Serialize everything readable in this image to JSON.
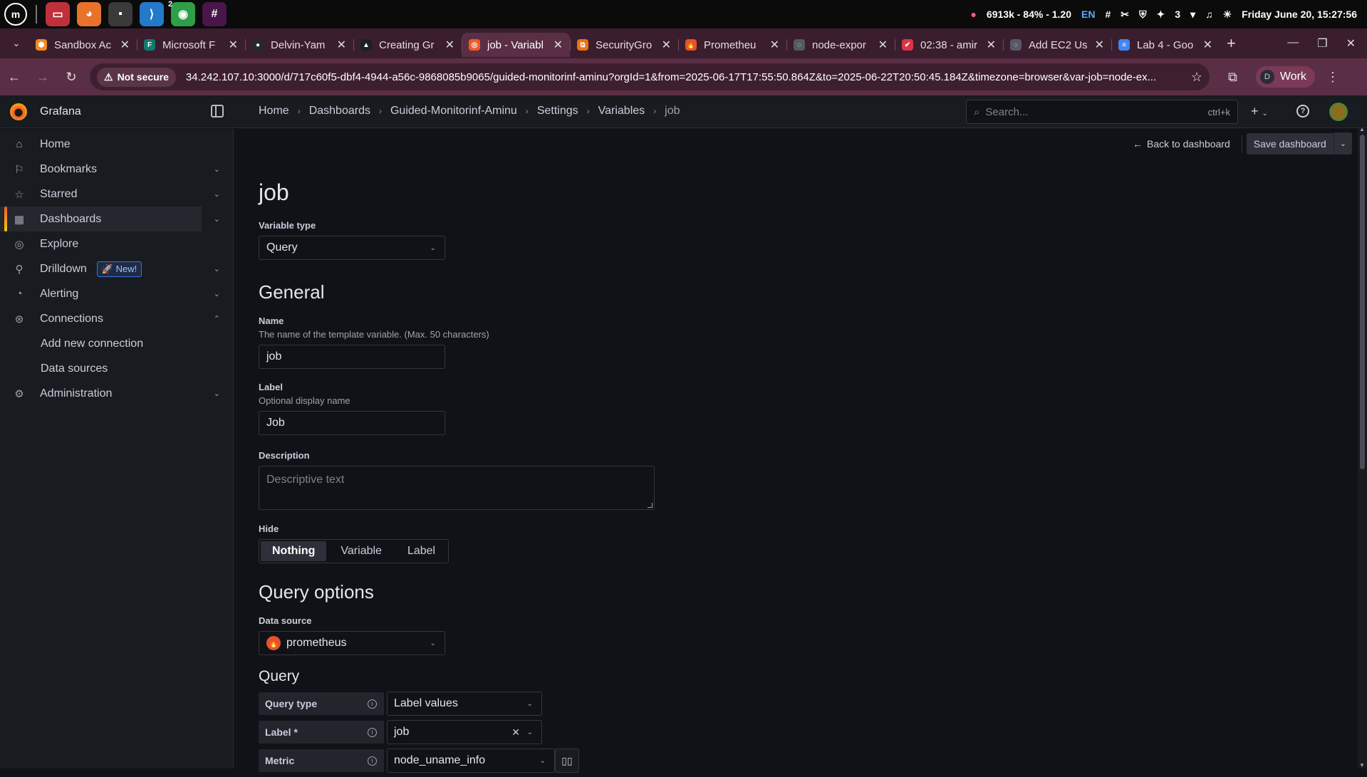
{
  "system": {
    "launcher_icon": "mint-launcher-icon",
    "apps": [
      {
        "name": "files-app-icon",
        "color": "#c0303a",
        "glyph": "▭"
      },
      {
        "name": "firefox-app-icon",
        "color": "#e8722c",
        "glyph": "◕"
      },
      {
        "name": "terminal-app-icon",
        "color": "#3a3a3a",
        "glyph": "▪"
      },
      {
        "name": "vscode-app-icon",
        "color": "#2479c9",
        "glyph": "⟩"
      },
      {
        "name": "chrome-app-icon",
        "color": "#2f9e48",
        "glyph": "◉",
        "badge": "2"
      },
      {
        "name": "slack-app-icon",
        "color": "#4a154b",
        "glyph": "#"
      }
    ],
    "net_status": "6913k - 84% - 1.20",
    "lang": "EN",
    "count": "3",
    "datetime": "Friday June 20, 15:27:56"
  },
  "browser": {
    "tabs": [
      {
        "title": "Sandbox Ac",
        "color": "#f28a26",
        "glyph": "⬢"
      },
      {
        "title": "Microsoft F",
        "color": "#0f7b6c",
        "glyph": "F"
      },
      {
        "title": "Delvin-Yam",
        "color": "#24292e",
        "glyph": "●"
      },
      {
        "title": "Creating Gr",
        "color": "#1b1f2a",
        "glyph": "▲"
      },
      {
        "title": "job - Variabl",
        "color": "#f05a28",
        "glyph": "◎",
        "active": true
      },
      {
        "title": "SecurityGro",
        "color": "#ec7211",
        "glyph": "⧉"
      },
      {
        "title": "Prometheu",
        "color": "#e6522c",
        "glyph": "🔥"
      },
      {
        "title": "node-expor",
        "color": "#555a66",
        "glyph": "◌"
      },
      {
        "title": "02:38 - amir",
        "color": "#db3545",
        "glyph": "✔"
      },
      {
        "title": "Add EC2 Us",
        "color": "#555a66",
        "glyph": "◌"
      },
      {
        "title": "Lab 4 - Goo",
        "color": "#4285f4",
        "glyph": "≡"
      }
    ],
    "not_secure": "Not secure",
    "url": "34.242.107.10:3000/d/717c60f5-dbf4-4944-a56c-9868085b9065/guided-monitorinf-aminu?orgId=1&from=2025-06-17T17:55:50.864Z&to=2025-06-22T20:50:45.184Z&timezone=browser&var-job=node-ex...",
    "profile_initial": "D",
    "profile_name": "Work"
  },
  "grafana": {
    "brand": "Grafana",
    "breadcrumb": [
      "Home",
      "Dashboards",
      "Guided-Monitorinf-Aminu",
      "Settings",
      "Variables",
      "job"
    ],
    "search_placeholder": "Search...",
    "search_shortcut": "ctrl+k",
    "back_label": "Back to dashboard",
    "save_label": "Save dashboard"
  },
  "sidebar": {
    "items": [
      {
        "label": "Home",
        "icon": "home-icon",
        "glyph": "⌂",
        "caret": ""
      },
      {
        "label": "Bookmarks",
        "icon": "bookmark-icon",
        "glyph": "⚐",
        "caret": "⌄"
      },
      {
        "label": "Starred",
        "icon": "star-icon",
        "glyph": "☆",
        "caret": "⌄"
      },
      {
        "label": "Dashboards",
        "icon": "dashboards-icon",
        "glyph": "▦",
        "caret": "⌄",
        "active": true
      },
      {
        "label": "Explore",
        "icon": "compass-icon",
        "glyph": "◎",
        "caret": ""
      },
      {
        "label": "Drilldown",
        "icon": "drilldown-icon",
        "glyph": "⚲",
        "caret": "⌄",
        "badge": "New!"
      },
      {
        "label": "Alerting",
        "icon": "bell-icon",
        "glyph": "◔",
        "caret": "⌄"
      },
      {
        "label": "Connections",
        "icon": "connections-icon",
        "glyph": "⊛",
        "caret": "⌃"
      }
    ],
    "subitems": [
      "Add new connection",
      "Data sources"
    ],
    "admin": {
      "label": "Administration",
      "icon": "gear-icon",
      "glyph": "⚙",
      "caret": "⌄"
    }
  },
  "variable": {
    "title": "job",
    "type_label": "Variable type",
    "type_value": "Query",
    "general_heading": "General",
    "name_label": "Name",
    "name_desc": "The name of the template variable. (Max. 50 characters)",
    "name_value": "job",
    "label_label": "Label",
    "label_desc": "Optional display name",
    "label_value": "Job",
    "description_label": "Description",
    "description_placeholder": "Descriptive text",
    "hide_label": "Hide",
    "hide_options": [
      "Nothing",
      "Variable",
      "Label"
    ],
    "hide_selected": "Nothing",
    "query_options_heading": "Query options",
    "datasource_label": "Data source",
    "datasource_value": "prometheus",
    "query_heading": "Query",
    "query_type_label": "Query type",
    "query_type_value": "Label values",
    "query_label_label": "Label *",
    "query_label_value": "job",
    "metric_label": "Metric",
    "metric_value": "node_uname_info"
  }
}
